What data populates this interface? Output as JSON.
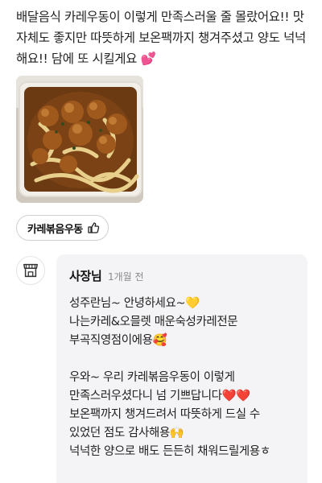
{
  "review": {
    "text": "배달음식 카레우동이 이렇게 만족스러울 줄 몰랐어요!! 맛 자체도 좋지만 따뜻하게 보온팩까지 챙겨주셨고 양도 넉넉해요!! 담에 또 시킬게요 💕"
  },
  "photo": {
    "icon": "food-photo"
  },
  "keyword_chip": {
    "label": "카레볶음우동",
    "icon": "thumbs-up-icon"
  },
  "owner_reply": {
    "name": "사장님",
    "time": "1개월 전",
    "avatar_icon": "store-icon",
    "lines": [
      "성주란님~ 안녕하세요~💛",
      "나는카레&오믈렛 매운숙성카레전문",
      "부곡직영점이에용🥰",
      "",
      "우와~ 우리 카레볶음우동이 이렇게",
      "만족스러우셨다니 넘 기쁘답니다❤️❤️",
      "보온팩까지 챙겨드려서 따뜻하게 드실 수",
      "있었던 점도 감사해용🙌",
      "넉넉한 양으로 배도 든든히 채워드릴게용ㅎ"
    ]
  },
  "colors": {
    "reply_bg": "#f4f4f6",
    "chip_border": "#d0d0d0",
    "time_gray": "#8a8a8a"
  }
}
